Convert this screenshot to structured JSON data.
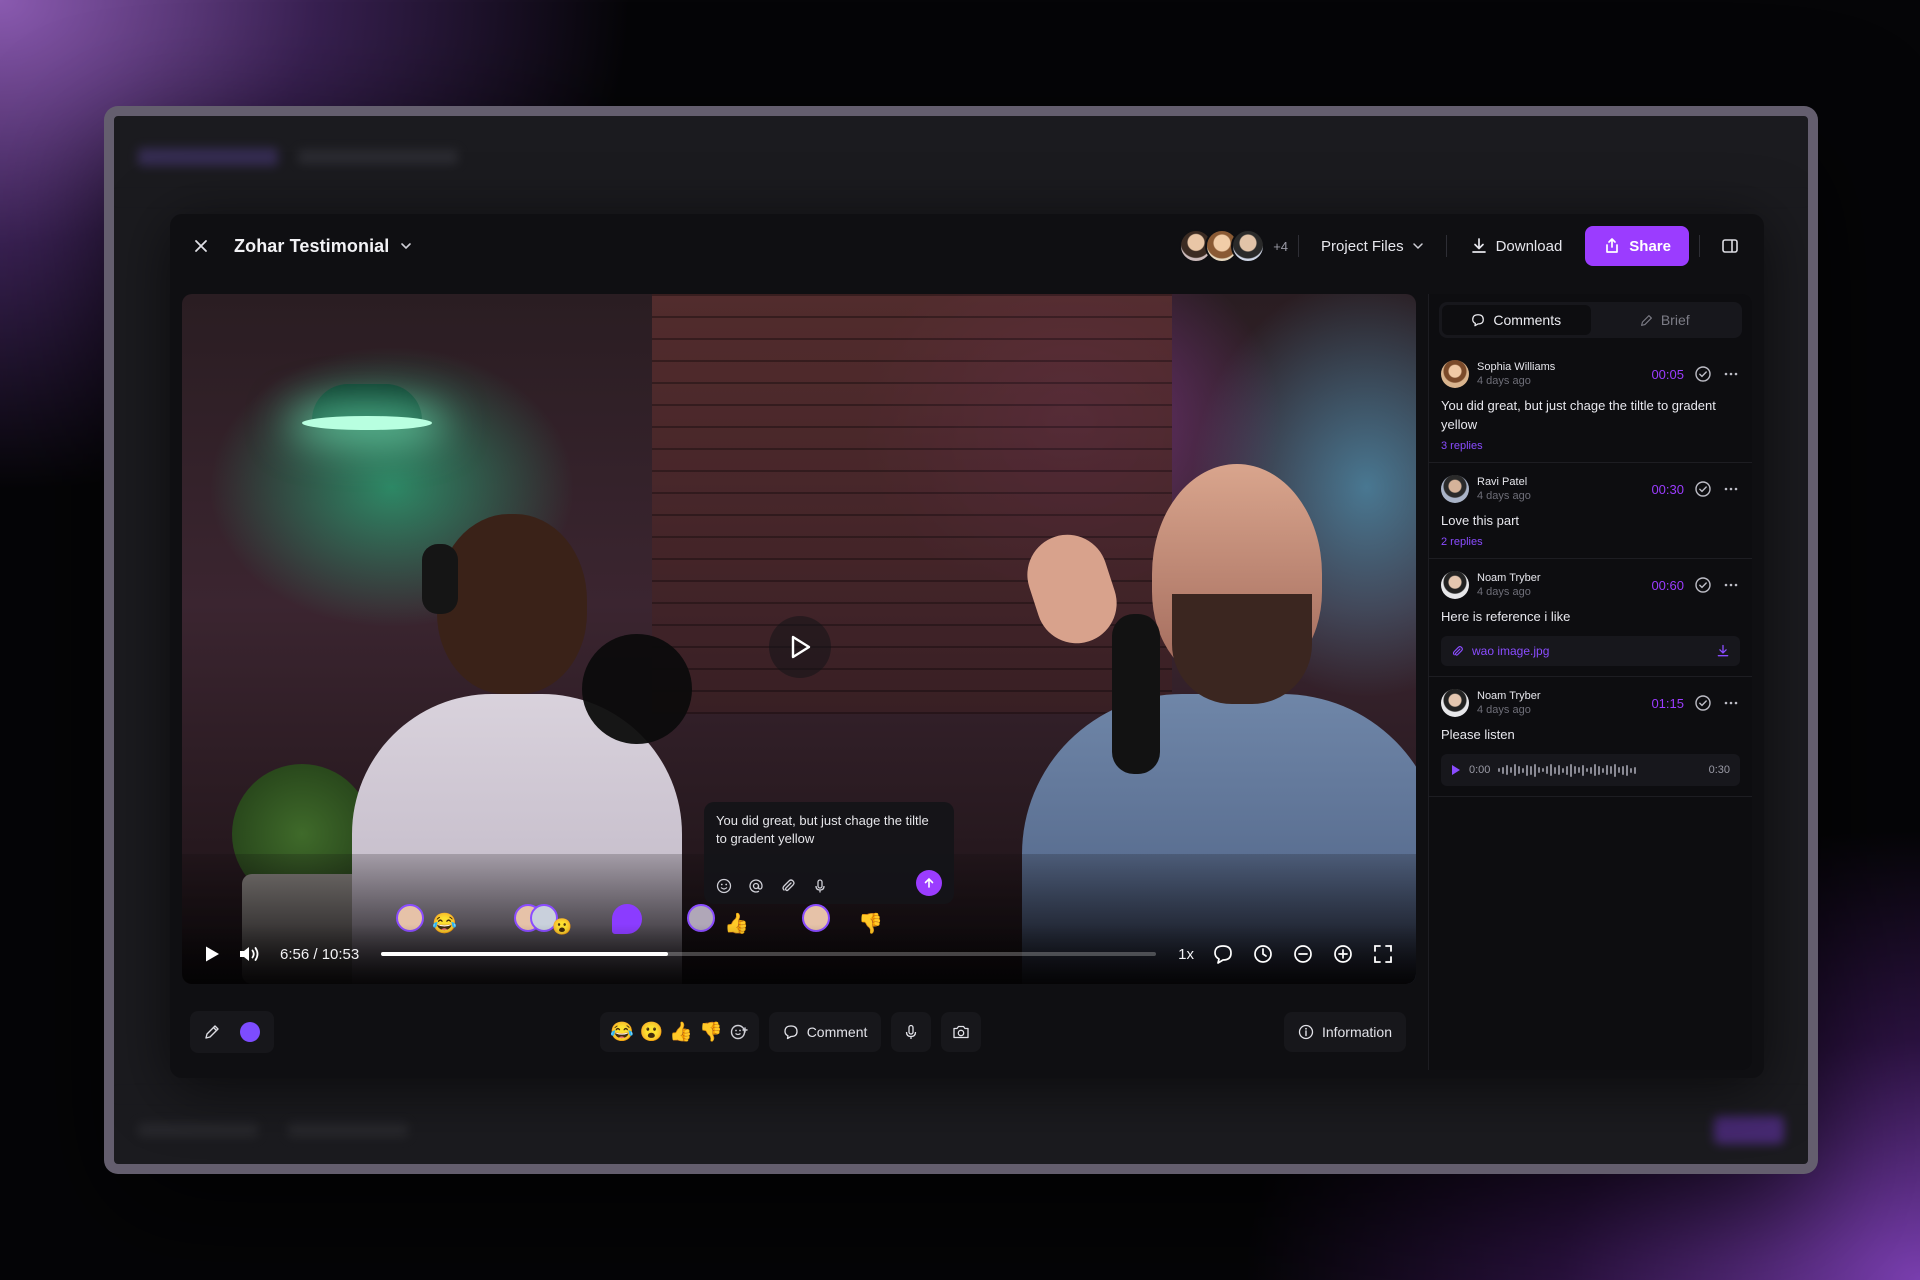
{
  "window": {
    "title": "Zohar Testimonial"
  },
  "header": {
    "collaborators_more": "+4",
    "project_files_label": "Project Files",
    "download_label": "Download",
    "share_label": "Share"
  },
  "player": {
    "current_time": "6:56",
    "duration": "10:53",
    "time_display": "6:56 / 10:53",
    "progress_fraction": 0.37,
    "speed_label": "1x",
    "popup_comment": "You did great, but just chage the tiltle to gradent yellow",
    "timeline_emojis": [
      "😂",
      "😮",
      "👍",
      "👎"
    ]
  },
  "toolbar": {
    "reactions": [
      "😂",
      "😮",
      "👍",
      "👎"
    ],
    "comment_label": "Comment",
    "information_label": "Information",
    "accent_color": "#9b3cff"
  },
  "sidebar": {
    "tabs": [
      {
        "label": "Comments",
        "active": true
      },
      {
        "label": "Brief",
        "active": false
      }
    ],
    "comments": [
      {
        "author": "Sophia Williams",
        "ago": "4 days ago",
        "timestamp": "00:05",
        "text": "You did great, but just chage the tiltle to gradent yellow",
        "replies": "3 replies"
      },
      {
        "author": "Ravi Patel",
        "ago": "4 days ago",
        "timestamp": "00:30",
        "text": "Love this part",
        "replies": "2 replies"
      },
      {
        "author": "Noam Tryber",
        "ago": "4 days ago",
        "timestamp": "00:60",
        "text": "Here is reference i like",
        "attachment": "wao image.jpg"
      },
      {
        "author": "Noam Tryber",
        "ago": "4 days ago",
        "timestamp": "01:15",
        "text": "Please listen",
        "audio_start": "0:00",
        "audio_end": "0:30"
      }
    ]
  }
}
